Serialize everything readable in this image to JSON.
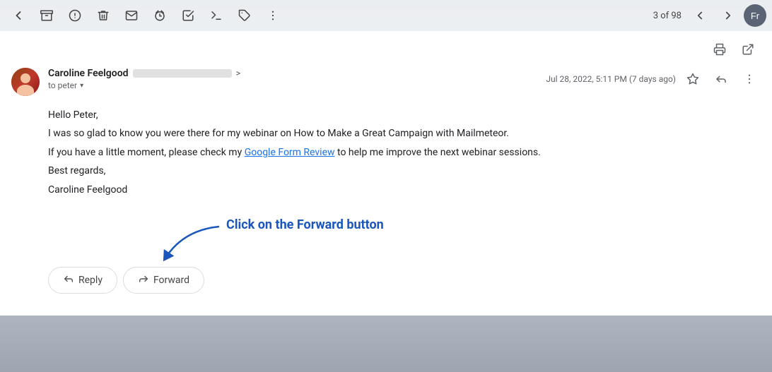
{
  "toolbar": {
    "counter": "3 of 98",
    "back_label": "←",
    "archive_label": "🗄",
    "spam_label": "⚠",
    "delete_label": "🗑",
    "mail_label": "✉",
    "snooze_label": "⏰",
    "done_label": "✓",
    "label_label": "🏷",
    "more_label": "⋮",
    "user_initials": "Fr"
  },
  "email_actions": {
    "print_label": "🖨",
    "popout_label": "⬡"
  },
  "email": {
    "sender_name": "Caroline Feelgood",
    "sender_email_end": ">",
    "to_label": "to peter",
    "date": "Jul 28, 2022, 5:11 PM (7 days ago)",
    "body": {
      "greeting": "Hello Peter,",
      "line1": "I was so glad to know you were there for my webinar on How to Make a Great Campaign with Mailmeteor.",
      "line2_before": "If you have a little moment, please check my ",
      "line2_link": "Google Form Review",
      "line2_after": " to help me improve the next webinar sessions.",
      "closing": "Best regards,",
      "signature": "Caroline Feelgood"
    },
    "annotation": "Click on the Forward button",
    "reply_label": "Reply",
    "forward_label": "Forward"
  }
}
